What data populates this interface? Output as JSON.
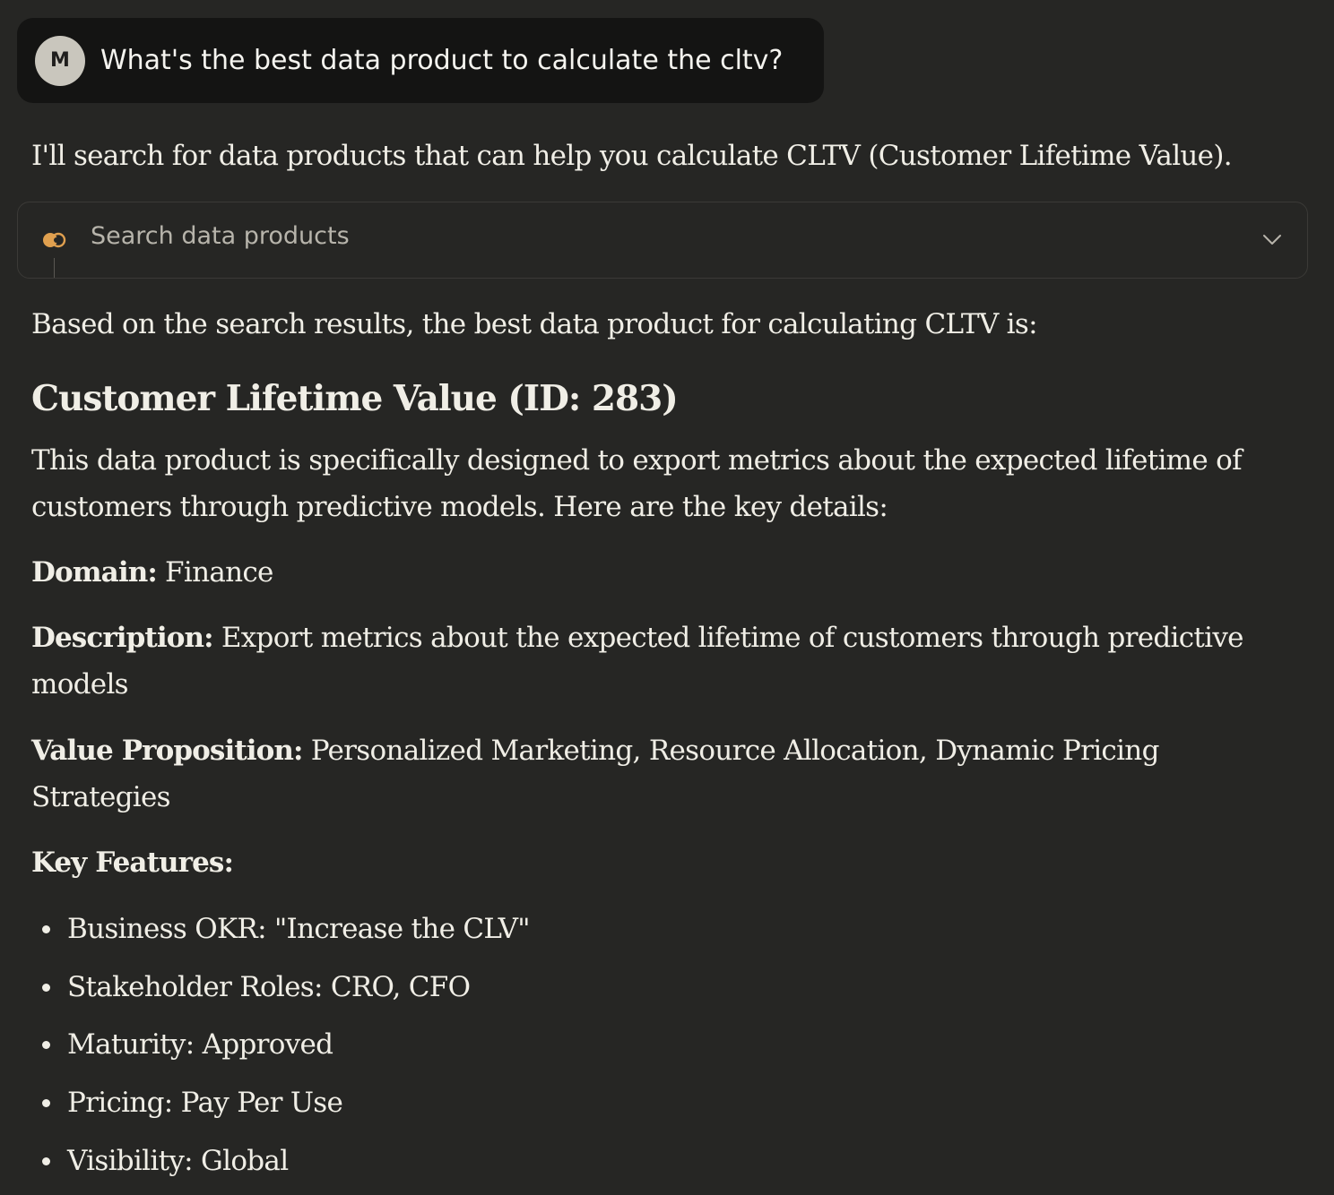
{
  "user_message": {
    "avatar_initial": "M",
    "text": "What's the best data product to calculate the cltv?"
  },
  "assistant": {
    "intro": "I'll search for data products that can help you calculate CLTV (Customer Lifetime Value).",
    "tool_call": {
      "label": "Search data products",
      "icon": "tool-icon",
      "expand_icon": "chevron-down-icon"
    },
    "result_intro": "Based on the search results, the best data product for calculating CLTV is:",
    "heading": "Customer Lifetime Value (ID: 283)",
    "summary_line1": "This data product is specifically designed to export metrics about the expected lifetime of",
    "summary_line2": "customers through predictive models. Here are the key details:",
    "domain_label": "Domain:",
    "domain_value": " Finance",
    "description_label": "Description:",
    "description_value_line1": " Export metrics about the expected lifetime of customers through predictive",
    "description_value_line2": "models",
    "value_prop_label": "Value Proposition:",
    "value_prop_line1": " Personalized Marketing, Resource Allocation, Dynamic Pricing",
    "value_prop_line2": "Strategies",
    "key_features_label": "Key Features:",
    "key_features": [
      "Business OKR: \"Increase the CLV\"",
      "Stakeholder Roles: CRO, CFO",
      "Maturity: Approved",
      "Pricing: Pay Per Use",
      "Visibility: Global"
    ]
  },
  "colors": {
    "background": "#262624",
    "user_bubble": "#141413",
    "text": "#f0eee6",
    "icon_accent": "#e0a04f"
  }
}
